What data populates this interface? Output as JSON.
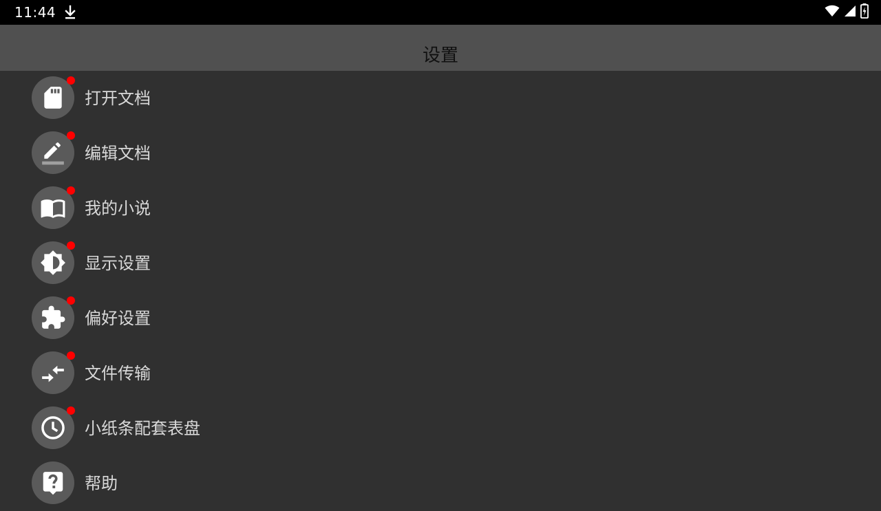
{
  "status_bar": {
    "time": "11:44",
    "icons": [
      "download-icon",
      "wifi-icon",
      "cell-signal-icon",
      "battery-charging-icon"
    ]
  },
  "app_bar": {
    "title": "设置"
  },
  "colors": {
    "status_bar_bg": "#000000",
    "app_bar_bg": "#505050",
    "background": "#303030",
    "icon_circle": "#5a5a5a",
    "notification_dot": "#ff0000",
    "label_text": "#d8d8d8"
  },
  "menu": {
    "items": [
      {
        "label": "打开文档",
        "icon": "sd-card-icon",
        "has_dot": true
      },
      {
        "label": "编辑文档",
        "icon": "edit-pencil-icon",
        "has_dot": true
      },
      {
        "label": "我的小说",
        "icon": "open-book-icon",
        "has_dot": true
      },
      {
        "label": "显示设置",
        "icon": "brightness-icon",
        "has_dot": true
      },
      {
        "label": "偏好设置",
        "icon": "puzzle-piece-icon",
        "has_dot": true
      },
      {
        "label": "文件传输",
        "icon": "transfer-arrows-icon",
        "has_dot": true
      },
      {
        "label": "小纸条配套表盘",
        "icon": "clock-icon",
        "has_dot": true
      },
      {
        "label": "帮助",
        "icon": "help-icon",
        "has_dot": false
      }
    ]
  }
}
